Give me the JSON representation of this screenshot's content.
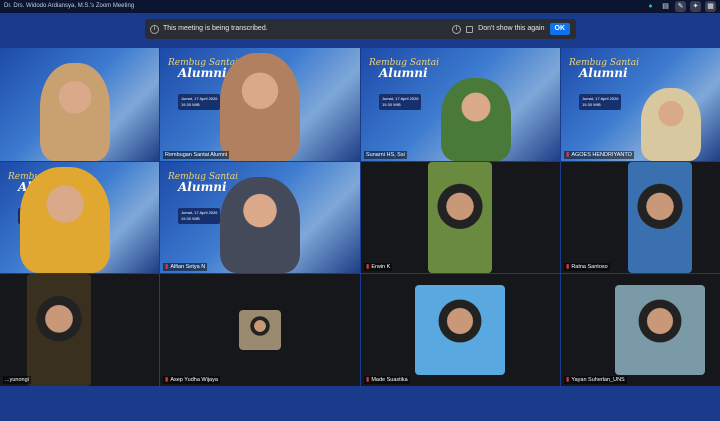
{
  "window": {
    "title": "Dr. Drs. Widodo Ardiansya, M.S.'s Zoom Meeting"
  },
  "banner": {
    "message": "This meeting is being transcribed.",
    "dont_show": "Don't show this again",
    "ok": "OK"
  },
  "background": {
    "title1": "Rembug Santai",
    "title2": "Alumni",
    "date": "Jumat, 17 April 2026",
    "time": "19.30 WIB"
  },
  "participants": [
    {
      "name": "",
      "muted": false
    },
    {
      "name": "Rembugan Santai Alumni",
      "muted": false
    },
    {
      "name": "Sunarni HS, Ssi",
      "muted": false
    },
    {
      "name": "AGOES HENDRIYANTO",
      "muted": true
    },
    {
      "name": "",
      "muted": false
    },
    {
      "name": "Alfian Setya N",
      "muted": true
    },
    {
      "name": "Erwin K",
      "muted": true
    },
    {
      "name": "Ratna Santoso",
      "muted": true
    },
    {
      "name": "...yunongi",
      "muted": false
    },
    {
      "name": "Asep Yudha Wijaya",
      "muted": true
    },
    {
      "name": "Made Suastika",
      "muted": true
    },
    {
      "name": "Yayan Suherlan_UNS",
      "muted": true
    }
  ],
  "colors": {
    "accent": "#0e72ed",
    "active_speaker": "#2fd3c9",
    "muted": "#e53935",
    "frame": "#1a3a8c"
  }
}
